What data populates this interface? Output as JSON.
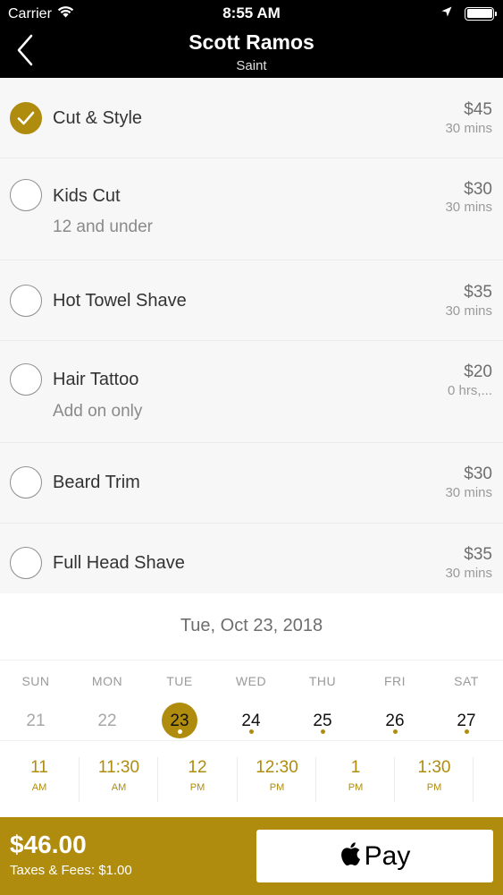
{
  "status_bar": {
    "carrier": "Carrier",
    "time": "8:55 AM"
  },
  "nav": {
    "title": "Scott Ramos",
    "subtitle": "Saint"
  },
  "services": [
    {
      "name": "Cut & Style",
      "note": "",
      "price": "$45",
      "duration": "30 mins",
      "selected": true
    },
    {
      "name": "Kids Cut",
      "note": "12 and under",
      "price": "$30",
      "duration": "30 mins",
      "selected": false
    },
    {
      "name": "Hot Towel Shave",
      "note": "",
      "price": "$35",
      "duration": "30 mins",
      "selected": false
    },
    {
      "name": "Hair Tattoo",
      "note": "Add on only",
      "price": "$20",
      "duration": "0 hrs,...",
      "selected": false
    },
    {
      "name": "Beard Trim",
      "note": "",
      "price": "$30",
      "duration": "30 mins",
      "selected": false
    },
    {
      "name": "Full Head Shave",
      "note": "",
      "price": "$35",
      "duration": "30 mins",
      "selected": false
    }
  ],
  "calendar": {
    "selected_date": "Tue, Oct 23, 2018",
    "days": [
      {
        "name": "SUN",
        "num": "21"
      },
      {
        "name": "MON",
        "num": "22"
      },
      {
        "name": "TUE",
        "num": "23"
      },
      {
        "name": "WED",
        "num": "24"
      },
      {
        "name": "THU",
        "num": "25"
      },
      {
        "name": "FRI",
        "num": "26"
      },
      {
        "name": "SAT",
        "num": "27"
      }
    ]
  },
  "times": [
    {
      "time": "11",
      "ampm": "AM"
    },
    {
      "time": "11:30",
      "ampm": "AM"
    },
    {
      "time": "12",
      "ampm": "PM"
    },
    {
      "time": "12:30",
      "ampm": "PM"
    },
    {
      "time": "1",
      "ampm": "PM"
    },
    {
      "time": "1:30",
      "ampm": "PM"
    }
  ],
  "footer": {
    "total": "$46.00",
    "fees": "Taxes & Fees: $1.00",
    "pay_label": "Pay"
  },
  "colors": {
    "accent": "#b08c0e",
    "nav_bg": "#000000"
  }
}
